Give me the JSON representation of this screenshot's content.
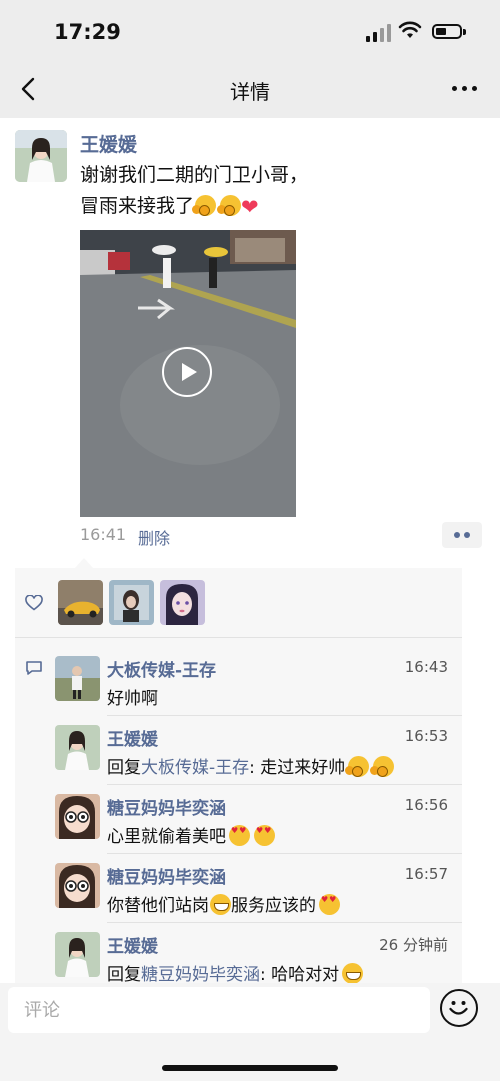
{
  "status_bar": {
    "time": "17:29"
  },
  "nav": {
    "title": "详情",
    "back_icon": "chevron-left-icon",
    "more_icon": "ellipsis-icon"
  },
  "post": {
    "author": "王媛媛",
    "text_line1": "谢谢我们二期的门卫小哥，",
    "text_line2": "冒雨来接我了",
    "time": "16:41",
    "delete_label": "删除"
  },
  "likes": {
    "icon": "heart-outline-icon",
    "count_shown": 3
  },
  "comments": [
    {
      "name": "大板传媒-王存",
      "time": "16:43",
      "text": "好帅啊"
    },
    {
      "name": "王媛媛",
      "time": "16:53",
      "reply_prefix": "回复",
      "reply_to": "大板传媒-王存",
      "text": ": 走过来好帅"
    },
    {
      "name": "糖豆妈妈毕奕涵",
      "time": "16:56",
      "text": "心里就偷着美吧"
    },
    {
      "name": "糖豆妈妈毕奕涵",
      "time": "16:57",
      "text": "你替他们站岗",
      "text2": "服务应该的"
    },
    {
      "name": "王媛媛",
      "time": "26 分钟前",
      "reply_prefix": "回复",
      "reply_to": "糖豆妈妈毕奕涵",
      "text": ": 哈哈对对"
    }
  ],
  "input": {
    "placeholder": "评论",
    "emoji_icon": "smiley-icon"
  },
  "colors": {
    "link": "#576b95",
    "background_bar": "#ededed",
    "panel": "#f7f7f7"
  }
}
